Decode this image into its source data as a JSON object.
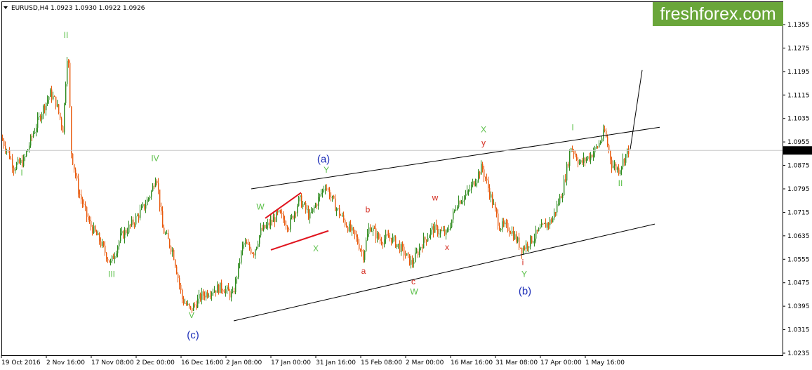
{
  "window": {
    "symbol_label": "EURUSD,H4  1.0923 1.0930 1.0922 1.0926",
    "brand": "freshforex.com"
  },
  "colors": {
    "bull_candle": "#2e8b1f",
    "bear_candle": "#e8590c",
    "trendline": "#000000",
    "triangle_line": "#e0141e",
    "green_label": "#5cc04a",
    "red_label": "#d42a1e",
    "blue_label": "#1e2fb8",
    "brand_bg": "#6aa63a",
    "grid": "#c8c8c8"
  },
  "chart_data": {
    "type": "candlestick",
    "title": "EURUSD,H4",
    "ohlc": {
      "open": 1.0923,
      "high": 1.093,
      "low": 1.0922,
      "close": 1.0926
    },
    "current_price": 1.0926,
    "y_axis": {
      "range": [
        1.02,
        1.142
      ],
      "ticks": [
        "1.1355",
        "1.1275",
        "1.1195",
        "1.1115",
        "1.1035",
        "1.0955",
        "1.0875",
        "1.0795",
        "1.0715",
        "1.0635",
        "1.0555",
        "1.0475",
        "1.0395",
        "1.0315",
        "1.0235"
      ],
      "current_label": "1.0926"
    },
    "x_axis": {
      "ticks": [
        "19 Oct 2016",
        "2 Nov 16:00",
        "17 Nov 08:00",
        "2 Dec 00:00",
        "16 Dec 16:00",
        "2 Jan 08:00",
        "17 Jan 00:00",
        "31 Jan 16:00",
        "15 Feb 08:00",
        "2 Mar 00:00",
        "16 Mar 16:00",
        "31 Mar 08:00",
        "17 Apr 00:00",
        "1 May 16:00"
      ]
    },
    "price_path": [
      {
        "t": 0,
        "p": 1.097
      },
      {
        "t": 10,
        "p": 1.092
      },
      {
        "t": 18,
        "p": 1.087
      },
      {
        "t": 32,
        "p": 1.089
      },
      {
        "t": 45,
        "p": 1.098
      },
      {
        "t": 58,
        "p": 1.106
      },
      {
        "t": 70,
        "p": 1.112
      },
      {
        "t": 78,
        "p": 1.109
      },
      {
        "t": 88,
        "p": 1.1
      },
      {
        "t": 95,
        "p": 1.129
      },
      {
        "t": 100,
        "p": 1.092
      },
      {
        "t": 110,
        "p": 1.079
      },
      {
        "t": 125,
        "p": 1.068
      },
      {
        "t": 140,
        "p": 1.062
      },
      {
        "t": 156,
        "p": 1.054
      },
      {
        "t": 170,
        "p": 1.063
      },
      {
        "t": 188,
        "p": 1.068
      },
      {
        "t": 205,
        "p": 1.074
      },
      {
        "t": 215,
        "p": 1.079
      },
      {
        "t": 221,
        "p": 1.085
      },
      {
        "t": 230,
        "p": 1.066
      },
      {
        "t": 245,
        "p": 1.058
      },
      {
        "t": 258,
        "p": 1.042
      },
      {
        "t": 270,
        "p": 1.038
      },
      {
        "t": 285,
        "p": 1.043
      },
      {
        "t": 300,
        "p": 1.045
      },
      {
        "t": 315,
        "p": 1.046
      },
      {
        "t": 330,
        "p": 1.043
      },
      {
        "t": 345,
        "p": 1.061
      },
      {
        "t": 360,
        "p": 1.058
      },
      {
        "t": 370,
        "p": 1.065
      },
      {
        "t": 380,
        "p": 1.067
      },
      {
        "t": 395,
        "p": 1.071
      },
      {
        "t": 410,
        "p": 1.067
      },
      {
        "t": 425,
        "p": 1.076
      },
      {
        "t": 440,
        "p": 1.07
      },
      {
        "t": 452,
        "p": 1.076
      },
      {
        "t": 462,
        "p": 1.081
      },
      {
        "t": 475,
        "p": 1.074
      },
      {
        "t": 490,
        "p": 1.068
      },
      {
        "t": 505,
        "p": 1.063
      },
      {
        "t": 516,
        "p": 1.057
      },
      {
        "t": 525,
        "p": 1.067
      },
      {
        "t": 540,
        "p": 1.062
      },
      {
        "t": 555,
        "p": 1.063
      },
      {
        "t": 570,
        "p": 1.059
      },
      {
        "t": 585,
        "p": 1.054
      },
      {
        "t": 600,
        "p": 1.061
      },
      {
        "t": 615,
        "p": 1.066
      },
      {
        "t": 635,
        "p": 1.064
      },
      {
        "t": 650,
        "p": 1.075
      },
      {
        "t": 665,
        "p": 1.078
      },
      {
        "t": 685,
        "p": 1.087
      },
      {
        "t": 695,
        "p": 1.079
      },
      {
        "t": 710,
        "p": 1.067
      },
      {
        "t": 725,
        "p": 1.066
      },
      {
        "t": 742,
        "p": 1.059
      },
      {
        "t": 755,
        "p": 1.062
      },
      {
        "t": 770,
        "p": 1.066
      },
      {
        "t": 785,
        "p": 1.069
      },
      {
        "t": 800,
        "p": 1.079
      },
      {
        "t": 812,
        "p": 1.094
      },
      {
        "t": 825,
        "p": 1.088
      },
      {
        "t": 840,
        "p": 1.091
      },
      {
        "t": 850,
        "p": 1.094
      },
      {
        "t": 860,
        "p": 1.099
      },
      {
        "t": 870,
        "p": 1.088
      },
      {
        "t": 880,
        "p": 1.086
      },
      {
        "t": 893,
        "p": 1.0926
      }
    ],
    "trendlines": [
      {
        "name": "channel-top-line",
        "from": {
          "t": 355,
          "p": 1.0795
        },
        "to": {
          "t": 937,
          "p": 1.1005
        }
      },
      {
        "name": "channel-bottom-line",
        "from": {
          "t": 330,
          "p": 1.0345
        },
        "to": {
          "t": 930,
          "p": 1.0675
        }
      },
      {
        "name": "projection-line",
        "from": {
          "t": 895,
          "p": 1.093
        },
        "to": {
          "t": 912,
          "p": 1.12
        }
      }
    ],
    "triangle_lines": [
      {
        "name": "triangle-upper-line",
        "from": {
          "t": 375,
          "p": 1.0695
        },
        "to": {
          "t": 426,
          "p": 1.0782
        }
      },
      {
        "name": "triangle-lower-line",
        "from": {
          "t": 383,
          "p": 1.0587
        },
        "to": {
          "t": 465,
          "p": 1.0652
        }
      }
    ],
    "wave_labels": [
      {
        "text": "II",
        "t": 91,
        "p": 1.131,
        "color": "green",
        "size": 12
      },
      {
        "text": "I",
        "t": 28,
        "p": 1.084,
        "color": "green",
        "size": 12
      },
      {
        "text": "III",
        "t": 156,
        "p": 1.0495,
        "color": "green",
        "size": 12
      },
      {
        "text": "IV",
        "t": 218,
        "p": 1.089,
        "color": "green",
        "size": 12
      },
      {
        "text": "V",
        "t": 270,
        "p": 1.0355,
        "color": "green",
        "size": 12
      },
      {
        "text": "(c)",
        "t": 272,
        "p": 1.0285,
        "color": "blue",
        "size": 15
      },
      {
        "text": "W",
        "t": 368,
        "p": 1.0725,
        "color": "green",
        "size": 12
      },
      {
        "text": "X",
        "t": 447,
        "p": 1.0582,
        "color": "green",
        "size": 12
      },
      {
        "text": "(a)",
        "t": 458,
        "p": 1.0885,
        "color": "blue",
        "size": 15
      },
      {
        "text": "Y",
        "t": 462,
        "p": 1.085,
        "color": "green",
        "size": 12
      },
      {
        "text": "b",
        "t": 521,
        "p": 1.0715,
        "color": "red",
        "size": 12
      },
      {
        "text": "a",
        "t": 515,
        "p": 1.0505,
        "color": "red",
        "size": 12
      },
      {
        "text": "c",
        "t": 586,
        "p": 1.047,
        "color": "red",
        "size": 12
      },
      {
        "text": "W",
        "t": 587,
        "p": 1.0435,
        "color": "green",
        "size": 12
      },
      {
        "text": "w",
        "t": 617,
        "p": 1.0755,
        "color": "red",
        "size": 12
      },
      {
        "text": "x",
        "t": 634,
        "p": 1.0587,
        "color": "red",
        "size": 12
      },
      {
        "text": "X",
        "t": 686,
        "p": 1.0988,
        "color": "green",
        "size": 12
      },
      {
        "text": "y",
        "t": 686,
        "p": 1.0942,
        "color": "red",
        "size": 12
      },
      {
        "text": "i",
        "t": 742,
        "p": 1.0535,
        "color": "red",
        "size": 12
      },
      {
        "text": "Y",
        "t": 744,
        "p": 1.0495,
        "color": "green",
        "size": 12
      },
      {
        "text": "(b)",
        "t": 745,
        "p": 1.0435,
        "color": "blue",
        "size": 15
      },
      {
        "text": "I",
        "t": 813,
        "p": 1.0995,
        "color": "green",
        "size": 12
      },
      {
        "text": "II",
        "t": 881,
        "p": 1.0805,
        "color": "green",
        "size": 12
      }
    ]
  }
}
